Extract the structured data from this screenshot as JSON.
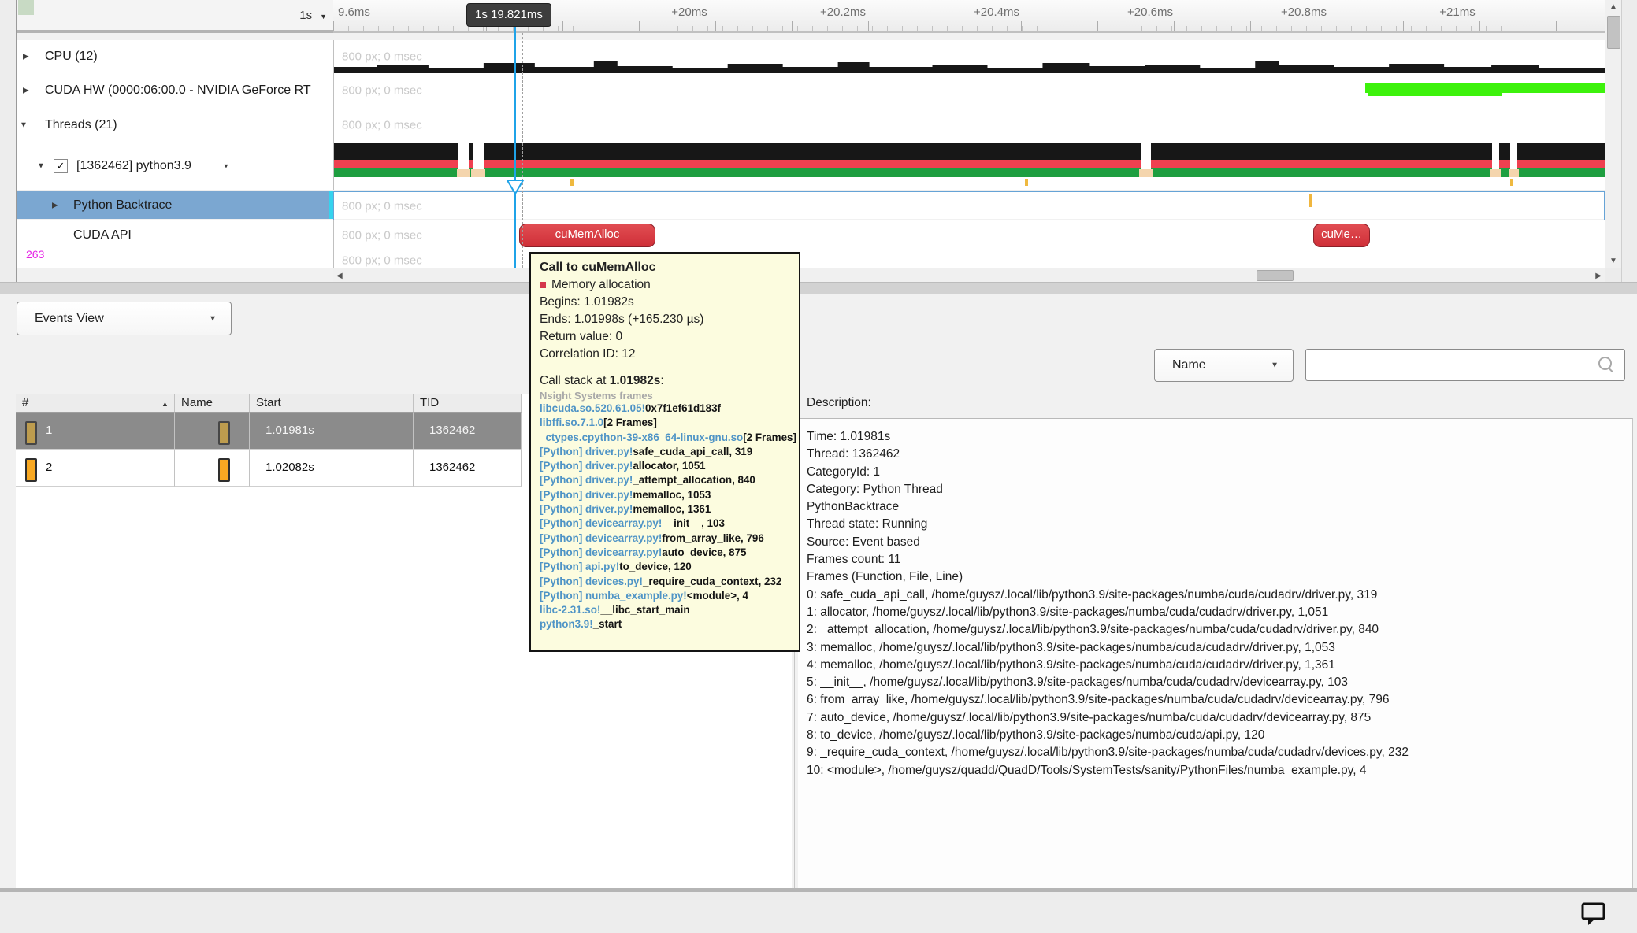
{
  "ruler": {
    "scale": "1s",
    "start_label": "9.6ms",
    "ticks": [
      "+20ms",
      "+20.2ms",
      "+20.4ms",
      "+20.6ms",
      "+20.8ms",
      "+21ms"
    ],
    "cursor_label": "1s 19.821ms"
  },
  "timeline": {
    "placeholder": "800 px; 0 msec",
    "sidebar": {
      "cpu": "CPU (12)",
      "cuda_hw": "CUDA HW (0000:06:00.0 - NVIDIA GeForce RT",
      "threads": "Threads (21)",
      "python_thread": "[1362462] python3.9",
      "python_backtrace": "Python Backtrace",
      "cuda_api": "CUDA API",
      "row_badge": "263"
    },
    "pills": {
      "first": "cuMemAlloc",
      "second": "cuMe…"
    }
  },
  "icons": {
    "collapsed": "▶",
    "expanded": "▼",
    "caret_down": "▼",
    "check": "✓",
    "sort_asc": "▲",
    "scroll_up": "▲",
    "scroll_down": "▼",
    "scroll_left": "◀",
    "scroll_right": "▶"
  },
  "colors": {
    "selection_blue": "#7ba7d1",
    "cursor_blue": "#1fa3e8",
    "event_pill_red": "#d53a45",
    "thread_black": "#171717",
    "thread_red": "#ef4050",
    "thread_green": "#1e9e40",
    "cuda_hw_green": "#3df20c",
    "tick_orange": "#efb93f",
    "badge_magenta": "#e522e5"
  },
  "events_view": {
    "label": "Events View"
  },
  "filter": {
    "field": "Name",
    "query": ""
  },
  "events_table": {
    "columns": [
      "#",
      "Name",
      "Start",
      "TID"
    ],
    "rows": [
      {
        "num": "1",
        "start": "1.01981s",
        "tid": "1362462"
      },
      {
        "num": "2",
        "start": "1.02082s",
        "tid": "1362462"
      }
    ]
  },
  "tooltip": {
    "title": "Call to cuMemAlloc",
    "category": "Memory allocation",
    "begins": "Begins: 1.01982s",
    "ends": "Ends: 1.01998s (+165.230 µs)",
    "return_value": "Return value: 0",
    "correlation": "Correlation ID: 12",
    "call_stack_prefix": "Call stack at ",
    "call_stack_time": "1.01982s",
    "call_stack_suffix": ":",
    "frames_header": "Nsight Systems frames",
    "stack": [
      {
        "module": "libcuda.so.520.61.05!",
        "symbol": "0x7f1ef61d183f"
      },
      {
        "module": "libffi.so.7.1.0",
        "symbol": "[2 Frames]"
      },
      {
        "module": "_ctypes.cpython-39-x86_64-linux-gnu.so",
        "symbol": "[2 Frames]"
      },
      {
        "module": "[Python] driver.py!",
        "symbol": "safe_cuda_api_call, 319"
      },
      {
        "module": "[Python] driver.py!",
        "symbol": "allocator, 1051"
      },
      {
        "module": "[Python] driver.py!",
        "symbol": "_attempt_allocation, 840"
      },
      {
        "module": "[Python] driver.py!",
        "symbol": "memalloc, 1053"
      },
      {
        "module": "[Python] driver.py!",
        "symbol": "memalloc, 1361"
      },
      {
        "module": "[Python] devicearray.py!",
        "symbol": "__init__, 103"
      },
      {
        "module": "[Python] devicearray.py!",
        "symbol": "from_array_like, 796"
      },
      {
        "module": "[Python] devicearray.py!",
        "symbol": "auto_device, 875"
      },
      {
        "module": "[Python] api.py!",
        "symbol": "to_device, 120"
      },
      {
        "module": "[Python] devices.py!",
        "symbol": "_require_cuda_context, 232"
      },
      {
        "module": "[Python] numba_example.py!",
        "symbol": "<module>, 4"
      },
      {
        "module": "libc-2.31.so!",
        "symbol": "__libc_start_main"
      },
      {
        "module": "python3.9!",
        "symbol": "_start"
      }
    ]
  },
  "description": {
    "label": "Description:",
    "lines": [
      "Time: 1.01981s",
      "Thread: 1362462",
      "CategoryId: 1",
      "Category: Python Thread",
      "PythonBacktrace",
      "Thread state: Running",
      "Source: Event based",
      "Frames count: 11",
      "Frames (Function, File, Line)",
      "0: safe_cuda_api_call, /home/guysz/.local/lib/python3.9/site-packages/numba/cuda/cudadrv/driver.py, 319",
      "1: allocator, /home/guysz/.local/lib/python3.9/site-packages/numba/cuda/cudadrv/driver.py, 1,051",
      "2: _attempt_allocation, /home/guysz/.local/lib/python3.9/site-packages/numba/cuda/cudadrv/driver.py, 840",
      "3: memalloc, /home/guysz/.local/lib/python3.9/site-packages/numba/cuda/cudadrv/driver.py, 1,053",
      "4: memalloc, /home/guysz/.local/lib/python3.9/site-packages/numba/cuda/cudadrv/driver.py, 1,361",
      "5: __init__, /home/guysz/.local/lib/python3.9/site-packages/numba/cuda/cudadrv/devicearray.py, 103",
      "6: from_array_like, /home/guysz/.local/lib/python3.9/site-packages/numba/cuda/cudadrv/devicearray.py, 796",
      "7: auto_device, /home/guysz/.local/lib/python3.9/site-packages/numba/cuda/cudadrv/devicearray.py, 875",
      "8: to_device, /home/guysz/.local/lib/python3.9/site-packages/numba/cuda/api.py, 120",
      "9: _require_cuda_context, /home/guysz/.local/lib/python3.9/site-packages/numba/cuda/cudadrv/devices.py, 232",
      "10: <module>, /home/guysz/quadd/QuadD/Tools/SystemTests/sanity/PythonFiles/numba_example.py, 4"
    ]
  }
}
